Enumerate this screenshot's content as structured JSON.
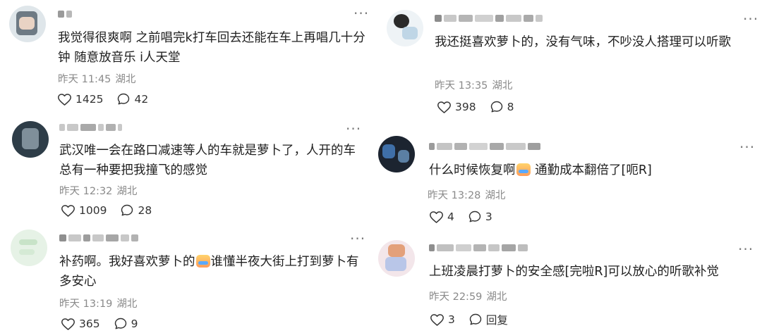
{
  "comments": [
    {
      "text": "我觉得很爽啊 之前唱完k打车回去还能在车上再唱几十分钟 随意放音乐 i人天堂",
      "time": "昨天 11:45",
      "location": "湖北",
      "likes": "1425",
      "replies": "42"
    },
    {
      "text": "武汉唯一会在路口减速等人的车就是萝卜了，人开的车总有一种要把我撞飞的感觉",
      "time": "昨天 12:32",
      "location": "湖北",
      "likes": "1009",
      "replies": "28"
    },
    {
      "text_before": "补药啊。我好喜欢萝卜的",
      "emoji": "emoji-sticker-icon",
      "text_after": "谁懂半夜大街上打到萝卜有多安心",
      "time": "昨天 13:19",
      "location": "湖北",
      "likes": "365",
      "replies": "9"
    },
    {
      "text": "我还挺喜欢萝卜的，没有气味，不吵没人搭理可以听歌",
      "time": "昨天 13:35",
      "location": "湖北",
      "likes": "398",
      "replies": "8"
    },
    {
      "text_before": "什么时候恢复啊",
      "emoji": "emoji-sticker-icon",
      "text_after": " 通勤成本翻倍了[呃R]",
      "time": "昨天 13:28",
      "location": "湖北",
      "likes": "4",
      "replies": "3"
    },
    {
      "text": "上班凌晨打萝卜的安全感[完啦R]可以放心的听歌补觉",
      "time": "昨天 22:59",
      "location": "湖北",
      "likes": "3",
      "replies": "回复"
    }
  ],
  "icons": {
    "like": "heart-outline-icon",
    "reply": "speech-bubble-icon",
    "more": "more-dots-icon"
  },
  "colors": {
    "meta": "#8a8a8a",
    "text": "#1f1f1f",
    "blur": "#c8c8c8"
  }
}
